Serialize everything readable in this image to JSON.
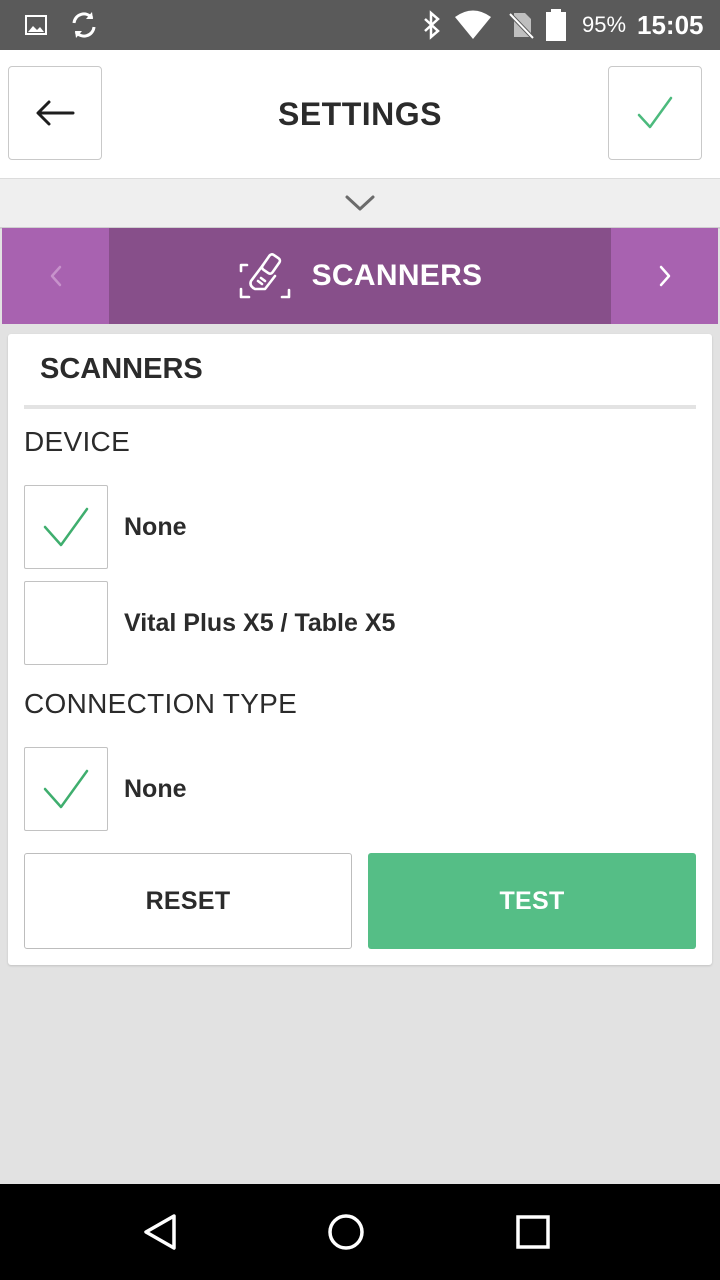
{
  "status_bar": {
    "battery_percent": "95%",
    "time": "15:05",
    "icons": [
      "image-icon",
      "sync-icon",
      "bluetooth-icon",
      "wifi-icon",
      "no-sim-icon",
      "battery-icon"
    ]
  },
  "header": {
    "title": "SETTINGS",
    "back_icon": "arrow-left-icon",
    "confirm_icon": "checkmark-icon"
  },
  "category_nav": {
    "title": "SCANNERS",
    "icon": "scanner-icon",
    "prev_icon": "chevron-left-icon",
    "next_icon": "chevron-right-icon"
  },
  "card": {
    "title": "SCANNERS",
    "device": {
      "label": "DEVICE",
      "options": [
        {
          "label": "None",
          "checked": true
        },
        {
          "label": "Vital Plus X5 / Table X5",
          "checked": false
        }
      ]
    },
    "connection": {
      "label": "CONNECTION TYPE",
      "options": [
        {
          "label": "None",
          "checked": true
        }
      ]
    },
    "buttons": {
      "reset": "RESET",
      "test": "TEST"
    }
  },
  "colors": {
    "accent_green": "#55be86",
    "category_purple": "#874f8a",
    "category_side_purple": "#a862b0",
    "check_green": "#3fae6e"
  }
}
